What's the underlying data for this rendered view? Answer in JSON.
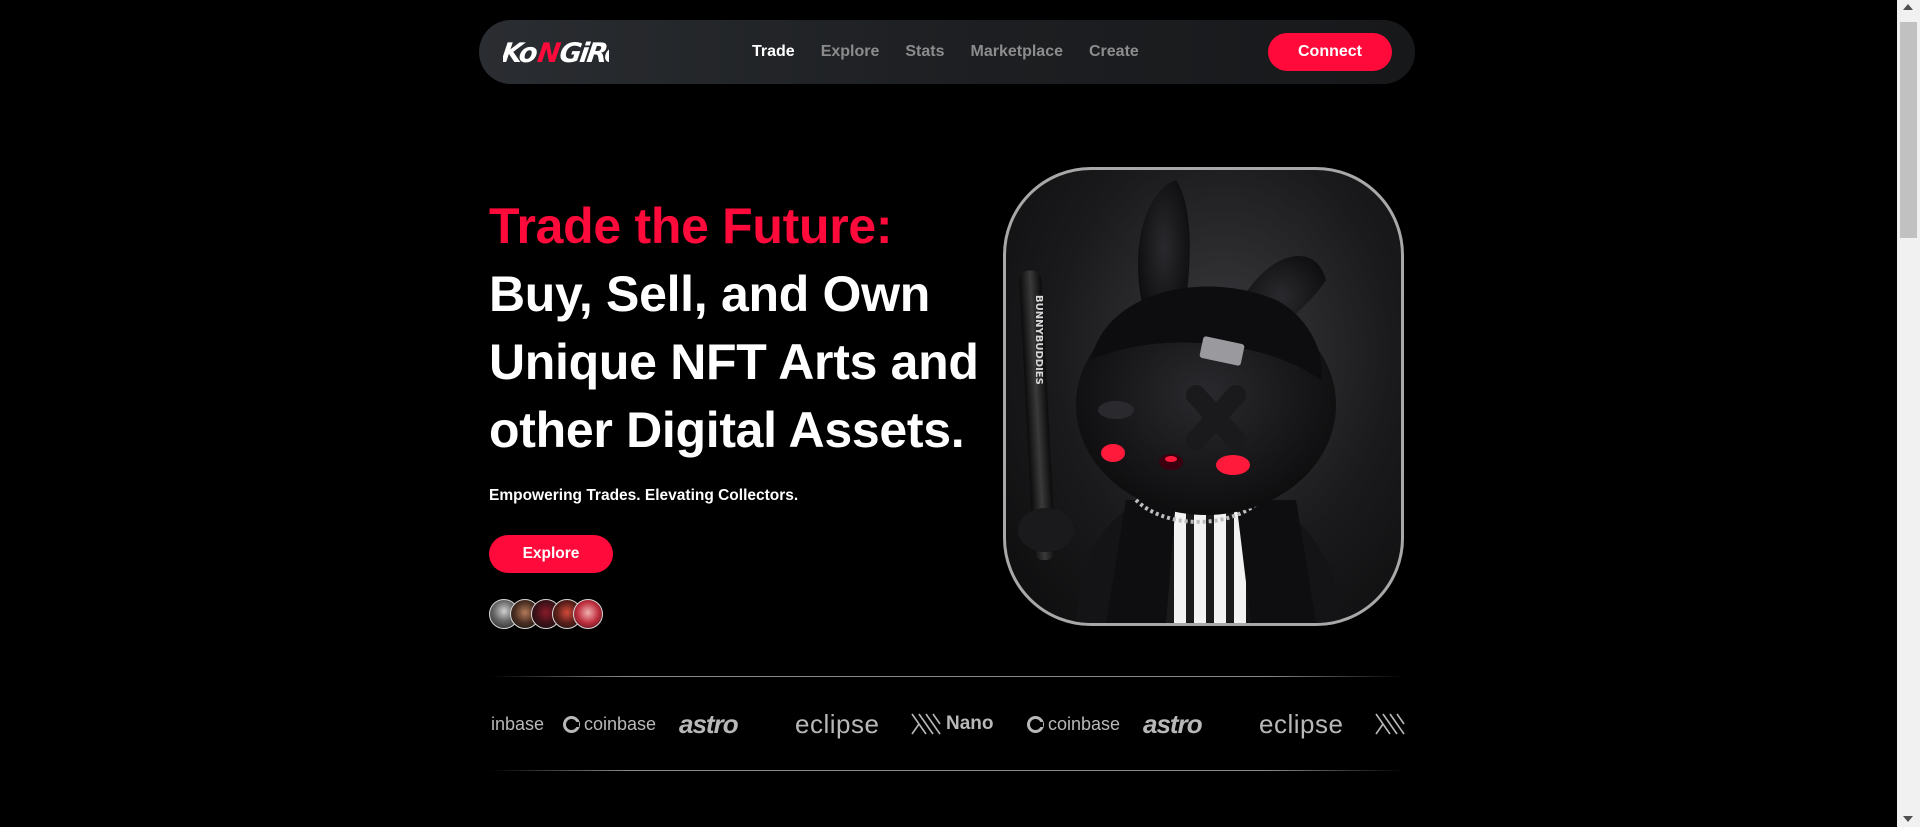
{
  "nav": {
    "logo_text": "KONGIRO",
    "links": [
      "Trade",
      "Explore",
      "Stats",
      "Marketplace",
      "Create"
    ],
    "active": "Trade",
    "connect_label": "Connect"
  },
  "hero": {
    "title_accent": "Trade the Future:",
    "title_main": "Buy, Sell, and Own Unique NFT Arts and other Digital Assets.",
    "tagline": "Empowering Trades. Elevating Collectors.",
    "explore_label": "Explore",
    "avatar_count": 5,
    "bat_text": "BUNNYBUDDIES"
  },
  "partners": [
    {
      "name": "inbase",
      "icon": "coinbase-logo-icon"
    },
    {
      "name": "coinbase",
      "icon": "coinbase-logo-icon"
    },
    {
      "name": "astro",
      "icon": "astro-logo"
    },
    {
      "name": "eclipse",
      "icon": "eclipse-logo"
    },
    {
      "name": "Nano",
      "icon": "nano-logo-icon"
    },
    {
      "name": "coinbase",
      "icon": "coinbase-logo-icon"
    },
    {
      "name": "astro",
      "icon": "astro-logo"
    },
    {
      "name": "eclipse",
      "icon": "eclipse-logo"
    }
  ],
  "colors": {
    "accent": "#ff0a3a",
    "background": "#000000",
    "nav_bg": "#1f2124",
    "muted_text": "#8c8c8c"
  }
}
